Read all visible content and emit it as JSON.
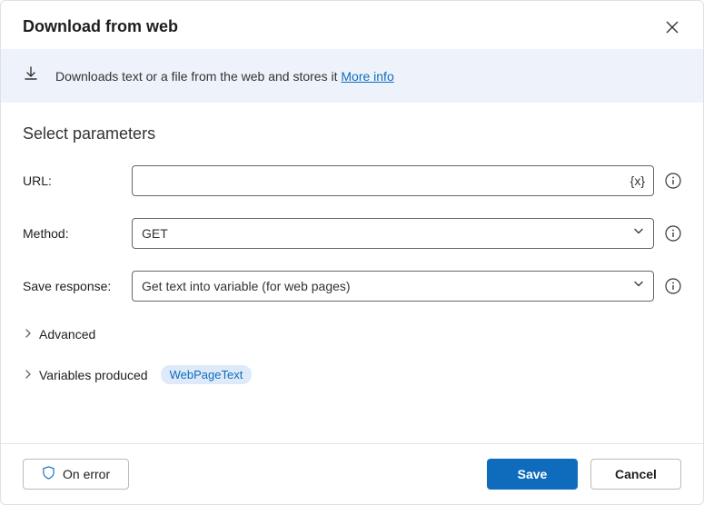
{
  "header": {
    "title": "Download from web"
  },
  "banner": {
    "text": "Downloads text or a file from the web and stores it ",
    "link": "More info"
  },
  "section": {
    "title": "Select parameters"
  },
  "fields": {
    "url": {
      "label": "URL:",
      "value": "",
      "var_symbol": "{x}"
    },
    "method": {
      "label": "Method:",
      "value": "GET"
    },
    "save_response": {
      "label": "Save response:",
      "value": "Get text into variable (for web pages)"
    }
  },
  "advanced": {
    "label": "Advanced"
  },
  "variables_produced": {
    "label": "Variables produced",
    "badge": "WebPageText"
  },
  "footer": {
    "on_error": "On error",
    "save": "Save",
    "cancel": "Cancel"
  }
}
